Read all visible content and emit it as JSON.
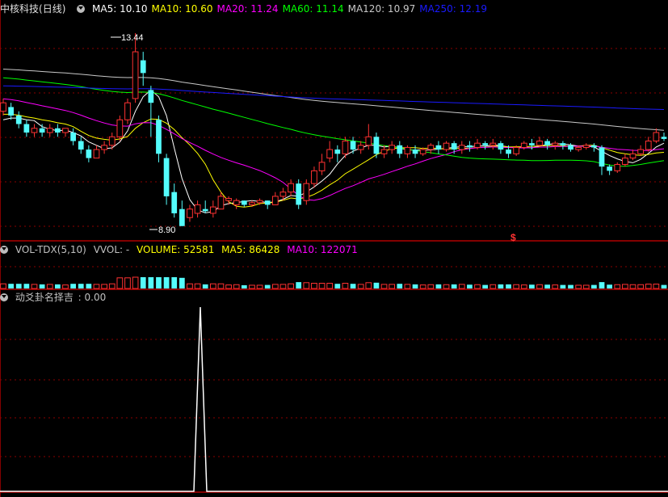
{
  "main": {
    "stock_name": "中核科技",
    "period": "(日线)",
    "ma": [
      {
        "label": "MA5: 10.10",
        "color": "#ffffff"
      },
      {
        "label": "MA10: 10.60",
        "color": "#ffff00"
      },
      {
        "label": "MA20: 11.24",
        "color": "#ff00ff"
      },
      {
        "label": "MA60: 11.14",
        "color": "#00ff00"
      },
      {
        "label": "MA120: 10.97",
        "color": "#c8c8c8"
      },
      {
        "label": "MA250: 12.19",
        "color": "#1a1aff"
      }
    ],
    "high_label": "13.44",
    "low_label": "8.90",
    "signal_mark": "$"
  },
  "volume": {
    "name": "VOL-TDX(5,10)",
    "vvol": "VVOL: -",
    "volume": "VOLUME: 52581",
    "ma5": "MA5: 86428",
    "ma10": "MA10: 122071"
  },
  "indicator": {
    "name": "动爻卦名择吉",
    "value": ": 0.00"
  },
  "colors": {
    "up": "#ff3232",
    "down": "#54fcfc",
    "grid": "#8b0000",
    "border": "#b00000"
  },
  "chart_data": {
    "type": "candlestick",
    "title": "中核科技 (日线)",
    "candles": [
      [
        11.6,
        11.8,
        11.9,
        11.5
      ],
      [
        11.7,
        11.5,
        11.8,
        11.4
      ],
      [
        11.5,
        11.3,
        11.6,
        11.2
      ],
      [
        11.3,
        11.1,
        11.4,
        11.0
      ],
      [
        11.1,
        11.2,
        11.3,
        11.0
      ],
      [
        11.2,
        11.1,
        11.3,
        11.0
      ],
      [
        11.1,
        11.2,
        11.3,
        11.0
      ],
      [
        11.2,
        11.1,
        11.3,
        11.0
      ],
      [
        11.1,
        11.2,
        11.2,
        11.0
      ],
      [
        11.1,
        10.9,
        11.2,
        10.8
      ],
      [
        10.9,
        10.7,
        11.0,
        10.6
      ],
      [
        10.7,
        10.5,
        10.8,
        10.4
      ],
      [
        10.5,
        10.7,
        10.8,
        10.5
      ],
      [
        10.7,
        10.8,
        10.9,
        10.6
      ],
      [
        10.8,
        11.0,
        11.1,
        10.7
      ],
      [
        11.0,
        11.4,
        11.5,
        10.9
      ],
      [
        11.4,
        11.8,
        11.9,
        11.3
      ],
      [
        11.9,
        13.0,
        13.44,
        11.8
      ],
      [
        12.8,
        12.5,
        13.0,
        12.2
      ],
      [
        12.1,
        11.8,
        12.2,
        11.0
      ],
      [
        11.4,
        10.6,
        11.5,
        10.4
      ],
      [
        10.5,
        9.6,
        10.6,
        9.4
      ],
      [
        9.7,
        9.2,
        9.9,
        9.1
      ],
      [
        9.3,
        8.9,
        9.5,
        8.9
      ],
      [
        9.1,
        9.3,
        9.4,
        9.0
      ],
      [
        9.2,
        9.4,
        9.5,
        9.1
      ],
      [
        9.3,
        9.25,
        9.5,
        9.2
      ],
      [
        9.2,
        9.35,
        9.5,
        9.1
      ],
      [
        9.3,
        9.6,
        9.7,
        9.3
      ],
      [
        9.5,
        9.55,
        9.6,
        9.4
      ],
      [
        9.4,
        9.5,
        9.55,
        9.3
      ],
      [
        9.5,
        9.4,
        9.5,
        9.35
      ],
      [
        9.4,
        9.45,
        9.5,
        9.35
      ],
      [
        9.45,
        9.5,
        9.55,
        9.4
      ],
      [
        9.5,
        9.4,
        9.5,
        9.3
      ],
      [
        9.4,
        9.6,
        9.7,
        9.4
      ],
      [
        9.6,
        9.7,
        9.8,
        9.5
      ],
      [
        9.7,
        9.9,
        10.0,
        9.6
      ],
      [
        9.9,
        9.4,
        10.0,
        9.3
      ],
      [
        9.5,
        9.9,
        10.0,
        9.4
      ],
      [
        9.9,
        10.2,
        10.3,
        9.8
      ],
      [
        10.2,
        10.4,
        10.6,
        10.1
      ],
      [
        10.5,
        10.7,
        10.9,
        10.4
      ],
      [
        10.7,
        10.6,
        10.8,
        10.4
      ],
      [
        10.6,
        10.9,
        11.0,
        10.5
      ],
      [
        10.9,
        10.7,
        11.0,
        10.6
      ],
      [
        10.7,
        10.8,
        10.9,
        10.6
      ],
      [
        10.8,
        11.0,
        11.3,
        10.7
      ],
      [
        11.0,
        10.6,
        11.1,
        10.5
      ],
      [
        10.6,
        10.7,
        10.8,
        10.5
      ],
      [
        10.7,
        10.8,
        10.9,
        10.6
      ],
      [
        10.8,
        10.6,
        10.9,
        10.5
      ],
      [
        10.6,
        10.75,
        10.8,
        10.5
      ],
      [
        10.7,
        10.6,
        10.8,
        10.5
      ],
      [
        10.6,
        10.7,
        10.75,
        10.55
      ],
      [
        10.7,
        10.8,
        10.85,
        10.6
      ],
      [
        10.8,
        10.7,
        10.9,
        10.6
      ],
      [
        10.7,
        10.85,
        10.9,
        10.65
      ],
      [
        10.85,
        10.7,
        10.9,
        10.6
      ],
      [
        10.7,
        10.8,
        10.9,
        10.6
      ],
      [
        10.8,
        10.75,
        10.9,
        10.65
      ],
      [
        10.75,
        10.85,
        10.95,
        10.7
      ],
      [
        10.85,
        10.8,
        10.9,
        10.7
      ],
      [
        10.8,
        10.85,
        10.95,
        10.7
      ],
      [
        10.85,
        10.7,
        10.9,
        10.6
      ],
      [
        10.7,
        10.6,
        10.8,
        10.5
      ],
      [
        10.6,
        10.75,
        10.8,
        10.55
      ],
      [
        10.75,
        10.85,
        10.9,
        10.7
      ],
      [
        10.85,
        10.8,
        10.95,
        10.7
      ],
      [
        10.8,
        10.9,
        11.0,
        10.75
      ],
      [
        10.9,
        10.8,
        10.95,
        10.7
      ],
      [
        10.8,
        10.85,
        10.9,
        10.7
      ],
      [
        10.85,
        10.8,
        10.9,
        10.7
      ],
      [
        10.8,
        10.7,
        10.85,
        10.65
      ],
      [
        10.7,
        10.75,
        10.8,
        10.65
      ],
      [
        10.75,
        10.8,
        10.85,
        10.7
      ],
      [
        10.8,
        10.75,
        10.85,
        10.65
      ],
      [
        10.75,
        10.3,
        10.8,
        10.1
      ],
      [
        10.3,
        10.2,
        10.35,
        10.1
      ],
      [
        10.2,
        10.35,
        10.4,
        10.15
      ],
      [
        10.35,
        10.5,
        10.6,
        10.3
      ],
      [
        10.5,
        10.6,
        10.7,
        10.45
      ],
      [
        10.6,
        10.7,
        10.8,
        10.55
      ],
      [
        10.7,
        10.9,
        11.0,
        10.65
      ],
      [
        10.9,
        11.1,
        11.2,
        10.85
      ],
      [
        11.0,
        10.95,
        11.1,
        10.9
      ]
    ]
  }
}
